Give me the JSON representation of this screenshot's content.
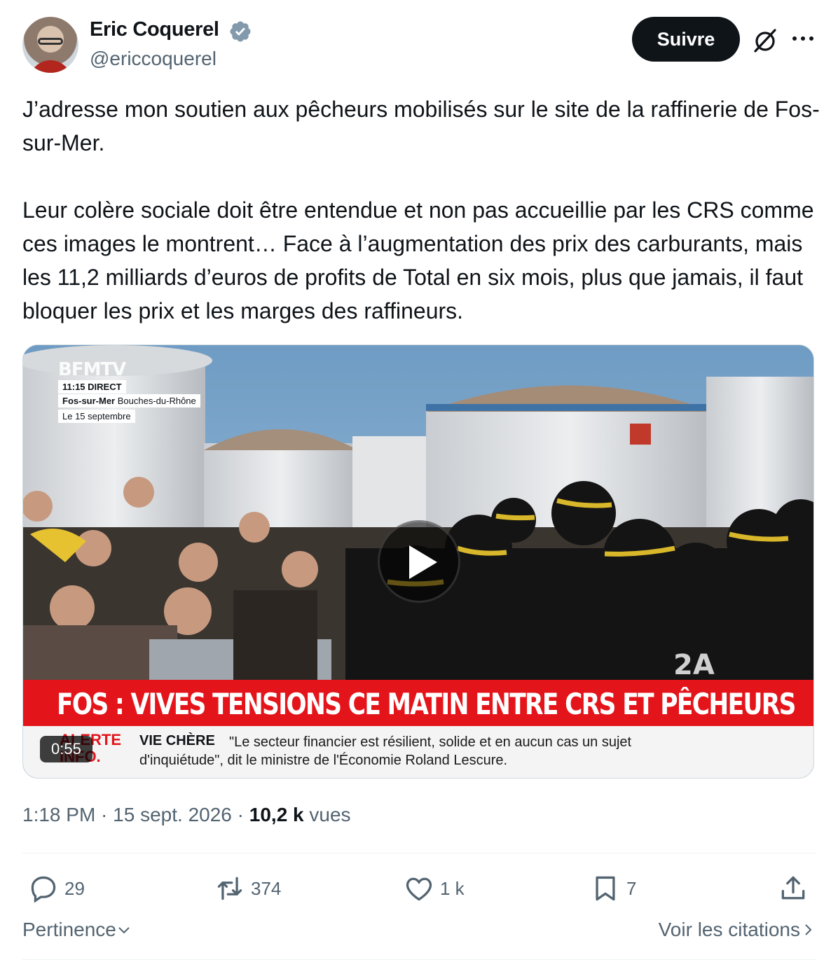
{
  "author": {
    "name": "Eric Coquerel",
    "handle": "@ericcoquerel",
    "verified_icon": "verified-badge-icon"
  },
  "header": {
    "follow_label": "Suivre",
    "grok_icon": "grok-icon",
    "more_icon": "more-icon"
  },
  "tweet": {
    "paragraphs": [
      "J’adresse mon soutien aux pêcheurs mobilisés sur le site de la raffinerie de Fos-sur-Mer.",
      "Leur colère sociale doit être entendue et non pas accueillie par les CRS comme ces images le montrent… Face à l’augmentation des prix des carburants, mais les 11,2 milliards d’euros de profits de Total en six mois, plus que jamais, il faut bloquer les prix et les marges des raffineurs."
    ]
  },
  "video": {
    "channel_logo": "BFMTV",
    "time_tag": "11:15  DIRECT",
    "place_bold": "Fos-sur-Mer",
    "place_rest": " Bouches-du-Rhône",
    "date_tag": "Le 15 septembre",
    "headline": "FOS : VIVES TENSIONS CE MATIN ENTRE CRS ET PÊCHEURS",
    "alert_line1": "ALERTE",
    "alert_line2": "INFO.",
    "ticker_label": "VIE CHÈRE",
    "ticker_text": "\"Le secteur financier est résilient, solide et en aucun cas un sujet d'inquiétude\", dit le ministre de l'Économie Roland Lescure.",
    "duration": "0:55",
    "play_icon": "play-icon"
  },
  "meta": {
    "time": "1:18 PM",
    "separator": " · ",
    "date": "15 sept. 2026",
    "views_count": "10,2 k",
    "views_label": " vues"
  },
  "actions": {
    "replies": "29",
    "reposts": "374",
    "likes": "1 k",
    "bookmarks": "7"
  },
  "footer": {
    "sort_label": "Pertinence",
    "quotes_label": "Voir les citations"
  },
  "colors": {
    "text": "#0f1419",
    "secondary": "#536471",
    "accent_red": "#e3151b"
  }
}
